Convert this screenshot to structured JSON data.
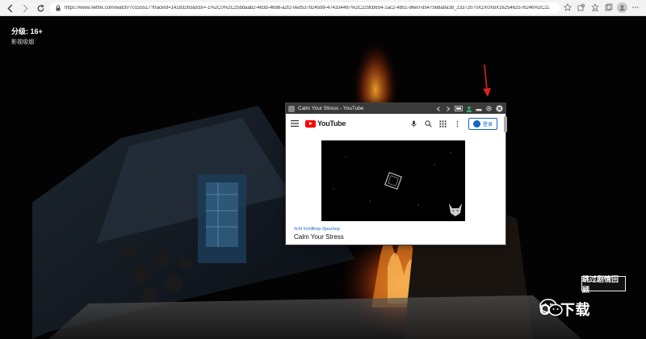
{
  "browser": {
    "url": "https://www.netflix.com/watch/70155517?trackId=14183263&tctx=-1%2C0%2C25bdaab2-463b-4698-a2f2-0ed537824599-474334497%2C229cb654-1ac2-4851-96e0-8547568a9a38_23372070X2X0X8X1625462576246%2C229cb654-1a...",
    "icons": [
      "back-icon",
      "forward-icon",
      "refresh-icon",
      "lock-icon",
      "star-icon",
      "extensions-icon",
      "favorites-icon",
      "collections-icon",
      "profile-icon",
      "more-icon"
    ]
  },
  "player": {
    "rating_title": "分级: 16+",
    "rating_subtitle": "影视吸烟",
    "skip_label": "跳过剧情回顾"
  },
  "watermark": {
    "text": "Ob下载"
  },
  "pip": {
    "window_title": "Calm Your Stress - YouTube",
    "controls": [
      "back-icon",
      "forward-icon",
      "cast-icon",
      "user-icon",
      "minimize-icon",
      "settings-icon",
      "close-icon"
    ],
    "youtube": {
      "logo_text": "YouTube",
      "signin_label": "登录",
      "video_tags": "#chi #chillhop #jazzhop",
      "video_title": "Calm Your Stress"
    }
  },
  "colors": {
    "annotation_red": "#e02020",
    "youtube_red": "#ff0000",
    "link_blue": "#1565c0"
  }
}
